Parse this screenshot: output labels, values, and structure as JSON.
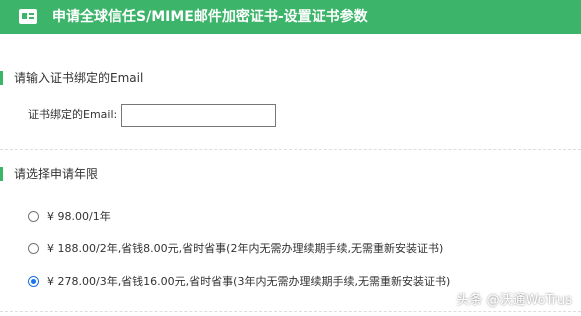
{
  "header": {
    "title": "申请全球信任S/MIME邮件加密证书-设置证书参数",
    "icon": "certificate-card-icon"
  },
  "email_section": {
    "title": "请输入证书绑定的Email",
    "label": "证书绑定的Email:",
    "input_value": ""
  },
  "term_section": {
    "title": "请选择申请年限",
    "options": [
      {
        "label": "¥ 98.00/1年",
        "checked": false
      },
      {
        "label": "¥ 188.00/2年,省钱8.00元,省时省事(2年内无需办理续期手续,无需重新安装证书)",
        "checked": false
      },
      {
        "label": "¥ 278.00/3年,省钱16.00元,省时省事(3年内无需办理续期手续,无需重新安装证书)",
        "checked": true
      }
    ]
  },
  "watermark": "头条 @沃通WoTrus",
  "colors": {
    "accent": "#3cb46a",
    "radio_checked": "#1a73e8"
  }
}
